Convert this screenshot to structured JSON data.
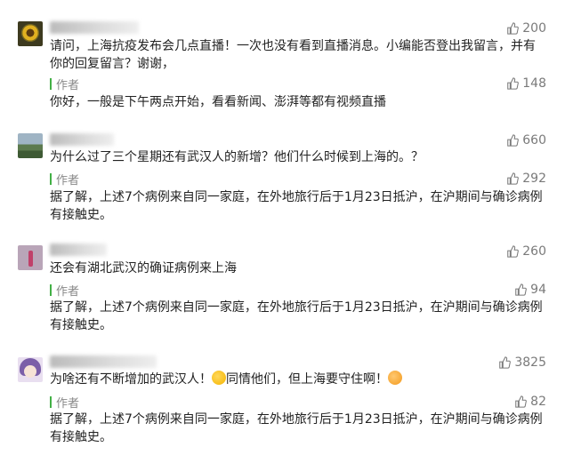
{
  "comments": [
    {
      "likes": "200",
      "text": "请问，上海抗疫发布会几点直播！一次也没有看到直播消息。小编能否登出我留言，并有你的回复留言？谢谢，",
      "reply": {
        "author_label": "作者",
        "likes": "148",
        "text": "你好，一般是下午两点开始，看看新闻、澎湃等都有视频直播"
      }
    },
    {
      "likes": "660",
      "text": "为什么过了三个星期还有武汉人的新增？他们什么时候到上海的。？",
      "reply": {
        "author_label": "作者",
        "likes": "292",
        "text": "据了解，上述7个病例来自同一家庭，在外地旅行后于1月23日抵沪，在沪期间与确诊病例有接触史。"
      }
    },
    {
      "likes": "260",
      "text": "还会有湖北武汉的确证病例来上海",
      "reply": {
        "author_label": "作者",
        "likes": "94",
        "text": "据了解，上述7个病例来自同一家庭，在外地旅行后于1月23日抵沪，在沪期间与确诊病例有接触史。"
      }
    },
    {
      "likes": "3825",
      "text_part1": "为啥还有不断增加的武汉人！",
      "text_part2": "同情他们，但上海要守住啊！",
      "reply": {
        "author_label": "作者",
        "likes": "82",
        "text": "据了解，上述7个病例来自同一家庭，在外地旅行后于1月23日抵沪，在沪期间与确诊病例有接触史。"
      }
    }
  ],
  "icons": {
    "like": "thumbs-up-icon"
  },
  "colors": {
    "author_bar": "#43b046",
    "like_text": "#7a7a7a"
  }
}
